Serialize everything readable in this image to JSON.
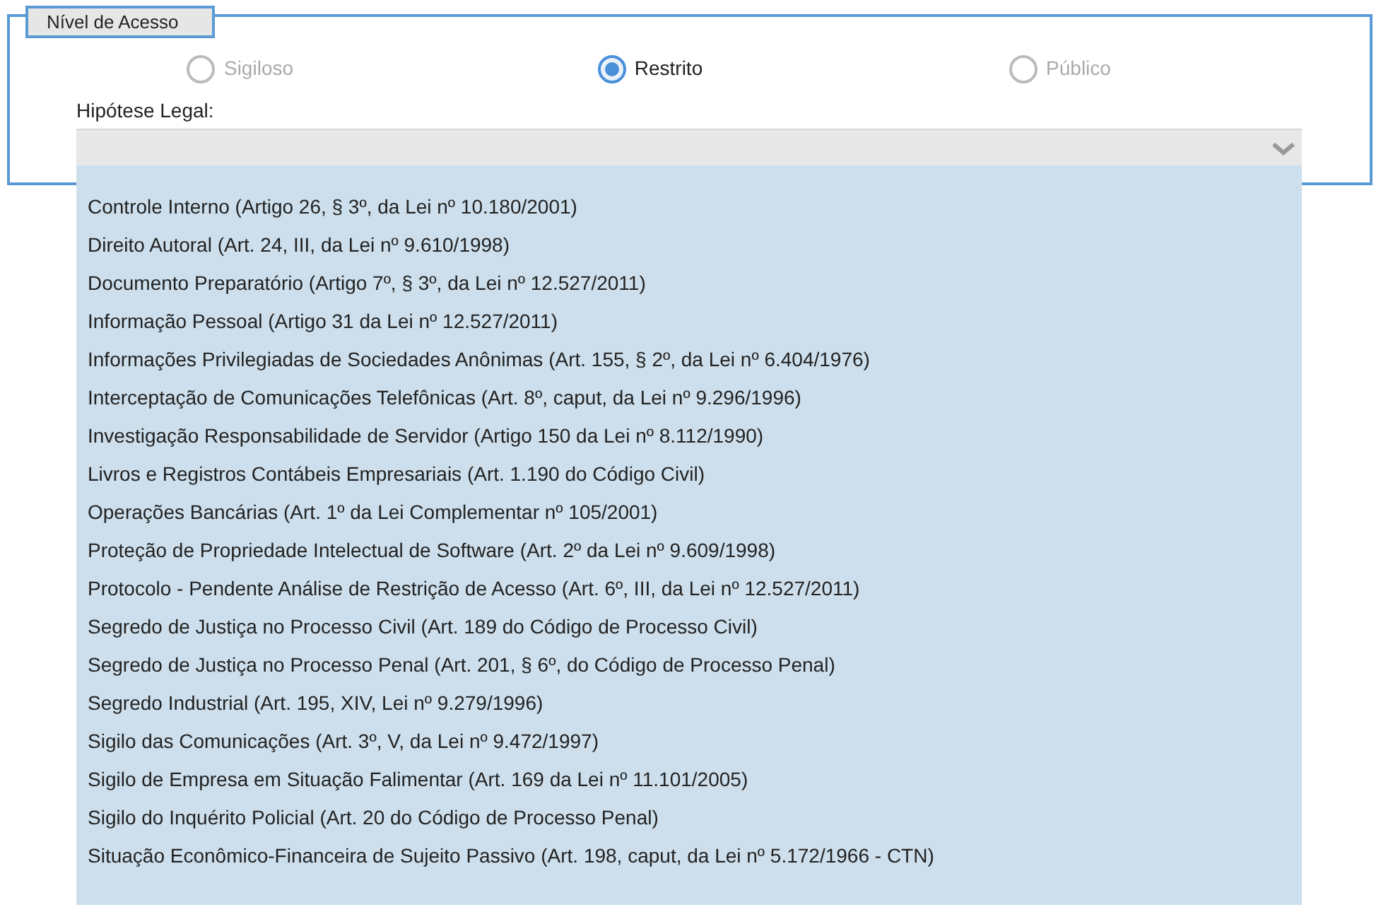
{
  "fieldset": {
    "legend": "Nível de Acesso"
  },
  "radios": [
    {
      "label": "Sigiloso",
      "selected": false,
      "disabled": true
    },
    {
      "label": "Restrito",
      "selected": true,
      "disabled": false
    },
    {
      "label": "Público",
      "selected": false,
      "disabled": true
    }
  ],
  "hipotese": {
    "label": "Hipótese Legal:",
    "expanded": true
  },
  "options": [
    "Controle Interno (Artigo 26, § 3º, da Lei nº 10.180/2001)",
    "Direito Autoral (Art. 24, III, da Lei nº 9.610/1998)",
    "Documento Preparatório (Artigo 7º, § 3º, da Lei nº 12.527/2011)",
    "Informação Pessoal (Artigo 31 da Lei nº 12.527/2011)",
    "Informações Privilegiadas de Sociedades Anônimas (Art. 155, § 2º, da Lei nº 6.404/1976)",
    "Interceptação de Comunicações Telefônicas (Art. 8º, caput, da Lei nº 9.296/1996)",
    "Investigação Responsabilidade de Servidor (Artigo 150 da Lei nº 8.112/1990)",
    "Livros e Registros Contábeis Empresariais (Art. 1.190 do Código Civil)",
    "Operações Bancárias (Art. 1º da Lei Complementar nº 105/2001)",
    "Proteção de Propriedade Intelectual de Software (Art. 2º da Lei nº 9.609/1998)",
    "Protocolo - Pendente Análise de Restrição de Acesso (Art. 6º, III, da Lei nº 12.527/2011)",
    "Segredo de Justiça no Processo Civil (Art. 189 do Código de Processo Civil)",
    "Segredo de Justiça no Processo Penal (Art. 201, § 6º, do Código de Processo Penal)",
    "Segredo Industrial (Art. 195, XIV, Lei nº 9.279/1996)",
    "Sigilo das Comunicações (Art. 3º, V, da Lei nº 9.472/1997)",
    "Sigilo de Empresa em Situação Falimentar (Art. 169 da Lei nº 11.101/2005)",
    "Sigilo do Inquérito Policial (Art. 20 do Código de Processo Penal)",
    "Situação Econômico-Financeira de Sujeito Passivo (Art. 198, caput, da Lei nº 5.172/1966 - CTN)"
  ]
}
